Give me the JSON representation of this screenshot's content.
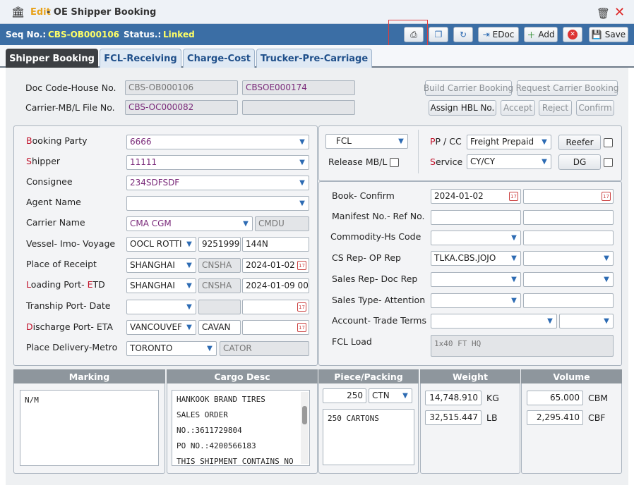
{
  "title": {
    "mode": "Edit",
    "name": "- OE Shipper Booking"
  },
  "seqbar": {
    "seq_label": "Seq No.:",
    "seq_value": "CBS-OB000106",
    "status_label": "Status.:",
    "status_value": "Linked"
  },
  "toolbar": {
    "edoc": "EDoc",
    "add": "Add",
    "save": "Save"
  },
  "tabs": [
    "Shipper Booking",
    "FCL-Receiving",
    "Charge-Cost",
    "Trucker-Pre-Carriage"
  ],
  "header": {
    "doc_code_label": "Doc Code-House No.",
    "doc_code_value": "CBS-OB000106",
    "house_no_value": "CBSOE000174",
    "carrier_mbl_label": "Carrier-MB/L File No.",
    "carrier_mbl_value": "",
    "file_no_value": "CBS-OC000082",
    "build_btn": "Build Carrier Booking",
    "request_btn": "Request Carrier Booking",
    "assign_btn": "Assign HBL No.",
    "accept_btn": "Accept",
    "reject_btn": "Reject",
    "confirm_btn": "Confirm"
  },
  "left": {
    "booking_party": {
      "label_r": "B",
      "label": "ooking Party",
      "value": "6666"
    },
    "shipper": {
      "label_r": "S",
      "label": "hipper",
      "value": "11111"
    },
    "consignee": {
      "label": "Consignee",
      "value": "234SDFSDF"
    },
    "agent": {
      "label": "Agent Name",
      "value": ""
    },
    "carrier": {
      "label": "Carrier Name",
      "value": "CMA CGM",
      "code": "CMDU"
    },
    "vessel": {
      "label": "Vessel- Imo- Voyage",
      "value": "OOCL ROTTI",
      "imo": "9251999",
      "voyage": "144N"
    },
    "receipt": {
      "label": "Place of Receipt",
      "value": "SHANGHAI",
      "code": "CNSHA",
      "date": "2024-01-02"
    },
    "loading": {
      "label_r1": "L",
      "label1": "oading Port- ",
      "label_r2": "E",
      "label2": "TD",
      "value": "SHANGHAI",
      "code": "CNSHA",
      "date": "2024-01-09 00:0"
    },
    "tranship": {
      "label": "Tranship Port- Date",
      "value": "",
      "code": "",
      "date": ""
    },
    "discharge": {
      "label_r": "D",
      "label": "ischarge Port- ETA",
      "value": "VANCOUVEF",
      "code": "CAVAN",
      "date": ""
    },
    "delivery": {
      "label": "Place Delivery-Metro",
      "value": "TORONTO",
      "code": "CATOR"
    }
  },
  "right": {
    "load_type": "FCL",
    "release_label": "Release MB/L",
    "ppcc_label_r1": "P",
    "ppcc_label1": "P / CC",
    "ppcc_value": "Freight Prepaid",
    "reefer_btn": "Reefer",
    "service_label_r": "S",
    "service_label": "ervice",
    "service_value": "CY/CY",
    "dg_btn": "DG",
    "book_confirm_label": "Book- Confirm",
    "book_date": "2024-01-02",
    "manifest_label": "Manifest No.- Ref No.",
    "commodity_label": "Commodity-Hs Code",
    "cs_rep_label": "CS Rep- OP Rep",
    "cs_rep_value": "TLKA.CBS.JOJO",
    "sales_rep_label": "Sales Rep- Doc Rep",
    "sales_type_label": "Sales Type- Attention",
    "account_label": "Account- Trade Terms",
    "fcl_load_label": "FCL Load",
    "fcl_load_value": "1x40 FT HQ"
  },
  "bottom": {
    "marking_hdr": "Marking",
    "marking_text": "N/M",
    "cargo_hdr": "Cargo Desc",
    "cargo_lines": [
      "HANKOOK BRAND TIRES",
      "SALES ORDER",
      "NO.:3611729804",
      "PO NO.:4200566183",
      "THIS SHIPMENT CONTAINS NO"
    ],
    "piece_hdr": "Piece/Packing",
    "piece_qty": "250",
    "piece_unit": "CTN",
    "piece_text": "250 CARTONS",
    "weight_hdr": "Weight",
    "weight_kg": "14,748.910",
    "kg": "KG",
    "weight_lb": "32,515.447",
    "lb": "LB",
    "volume_hdr": "Volume",
    "volume_cbm": "65.000",
    "cbm": "CBM",
    "volume_cbf": "2,295.410",
    "cbf": "CBF"
  },
  "colors": {
    "accent": "#3b6ea5",
    "status": "#ffff66",
    "required": "#c0122a"
  }
}
